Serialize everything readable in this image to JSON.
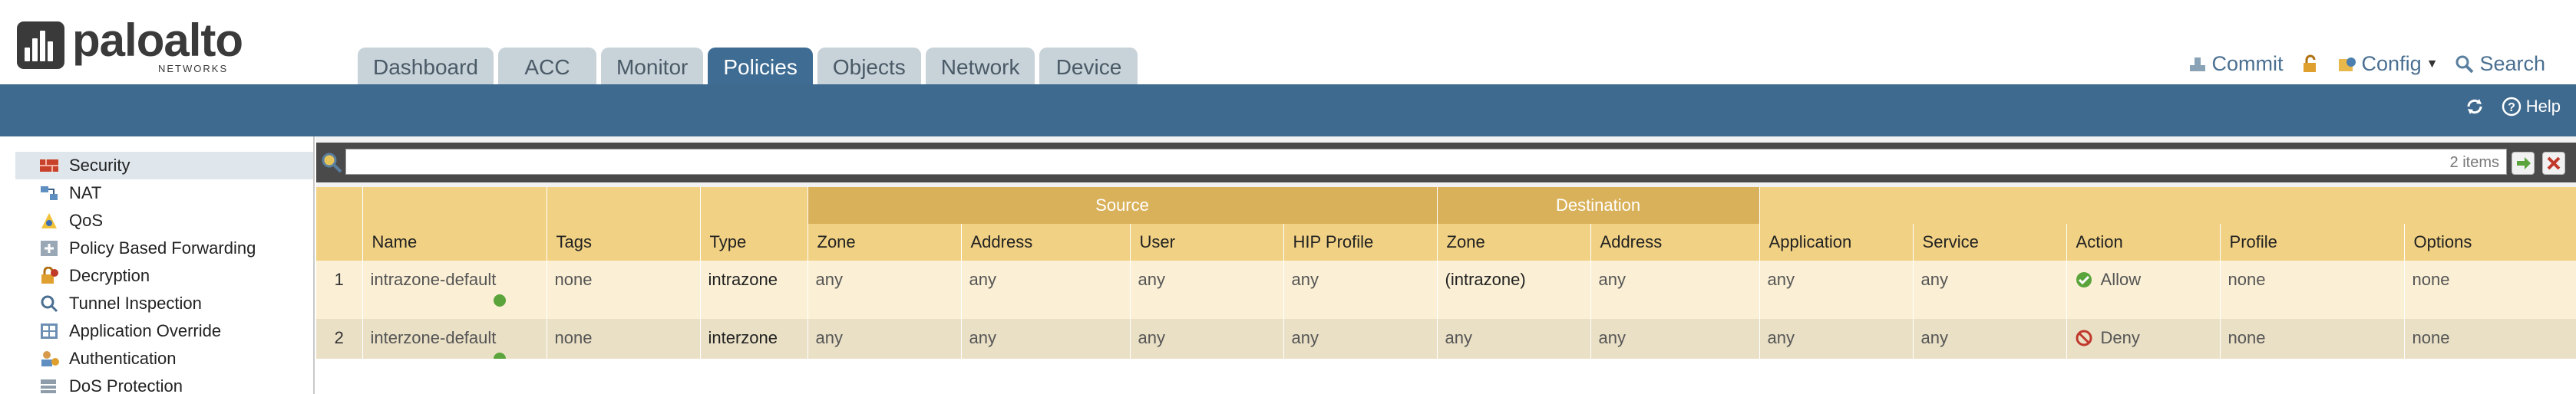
{
  "brand": {
    "name": "paloalto",
    "sub": "NETWORKS"
  },
  "tabs": [
    {
      "label": "Dashboard",
      "active": false
    },
    {
      "label": "ACC",
      "active": false
    },
    {
      "label": "Monitor",
      "active": false
    },
    {
      "label": "Policies",
      "active": true
    },
    {
      "label": "Objects",
      "active": false
    },
    {
      "label": "Network",
      "active": false
    },
    {
      "label": "Device",
      "active": false
    }
  ],
  "top_actions": {
    "commit": "Commit",
    "config": "Config",
    "search": "Search"
  },
  "band": {
    "help": "Help"
  },
  "sidebar": {
    "items": [
      {
        "label": "Security",
        "icon": "firewall-icon"
      },
      {
        "label": "NAT",
        "icon": "nat-icon"
      },
      {
        "label": "QoS",
        "icon": "qos-icon"
      },
      {
        "label": "Policy Based Forwarding",
        "icon": "pbf-icon"
      },
      {
        "label": "Decryption",
        "icon": "decryption-icon"
      },
      {
        "label": "Tunnel Inspection",
        "icon": "tunnel-icon"
      },
      {
        "label": "Application Override",
        "icon": "app-override-icon"
      },
      {
        "label": "Authentication",
        "icon": "authentication-icon"
      },
      {
        "label": "DoS Protection",
        "icon": "dos-icon"
      }
    ]
  },
  "search": {
    "value": "",
    "count": "2 items"
  },
  "table": {
    "groups": {
      "source": "Source",
      "destination": "Destination"
    },
    "columns": {
      "name": "Name",
      "tags": "Tags",
      "type": "Type",
      "src_zone": "Zone",
      "src_address": "Address",
      "src_user": "User",
      "src_hip": "HIP Profile",
      "dst_zone": "Zone",
      "dst_address": "Address",
      "application": "Application",
      "service": "Service",
      "action": "Action",
      "profile": "Profile",
      "options": "Options"
    },
    "rows": [
      {
        "num": "1",
        "name": "intrazone-default",
        "tags": "none",
        "type": "intrazone",
        "src_zone": "any",
        "src_address": "any",
        "src_user": "any",
        "src_hip": "any",
        "dst_zone": "(intrazone)",
        "dst_address": "any",
        "application": "any",
        "service": "any",
        "action": "Allow",
        "profile": "none",
        "options": "none"
      },
      {
        "num": "2",
        "name": "interzone-default",
        "tags": "none",
        "type": "interzone",
        "src_zone": "any",
        "src_address": "any",
        "src_user": "any",
        "src_hip": "any",
        "dst_zone": "any",
        "dst_address": "any",
        "application": "any",
        "service": "any",
        "action": "Deny",
        "profile": "none",
        "options": "none"
      }
    ]
  },
  "colors": {
    "header_band": "#3f6a8f",
    "tab_active": "#3e6c93",
    "tab_inactive": "#c7d2d9",
    "table_header": "#f1d184",
    "group_header": "#d9b15a",
    "row1": "#fbf0d5",
    "row2": "#eae0c6"
  }
}
